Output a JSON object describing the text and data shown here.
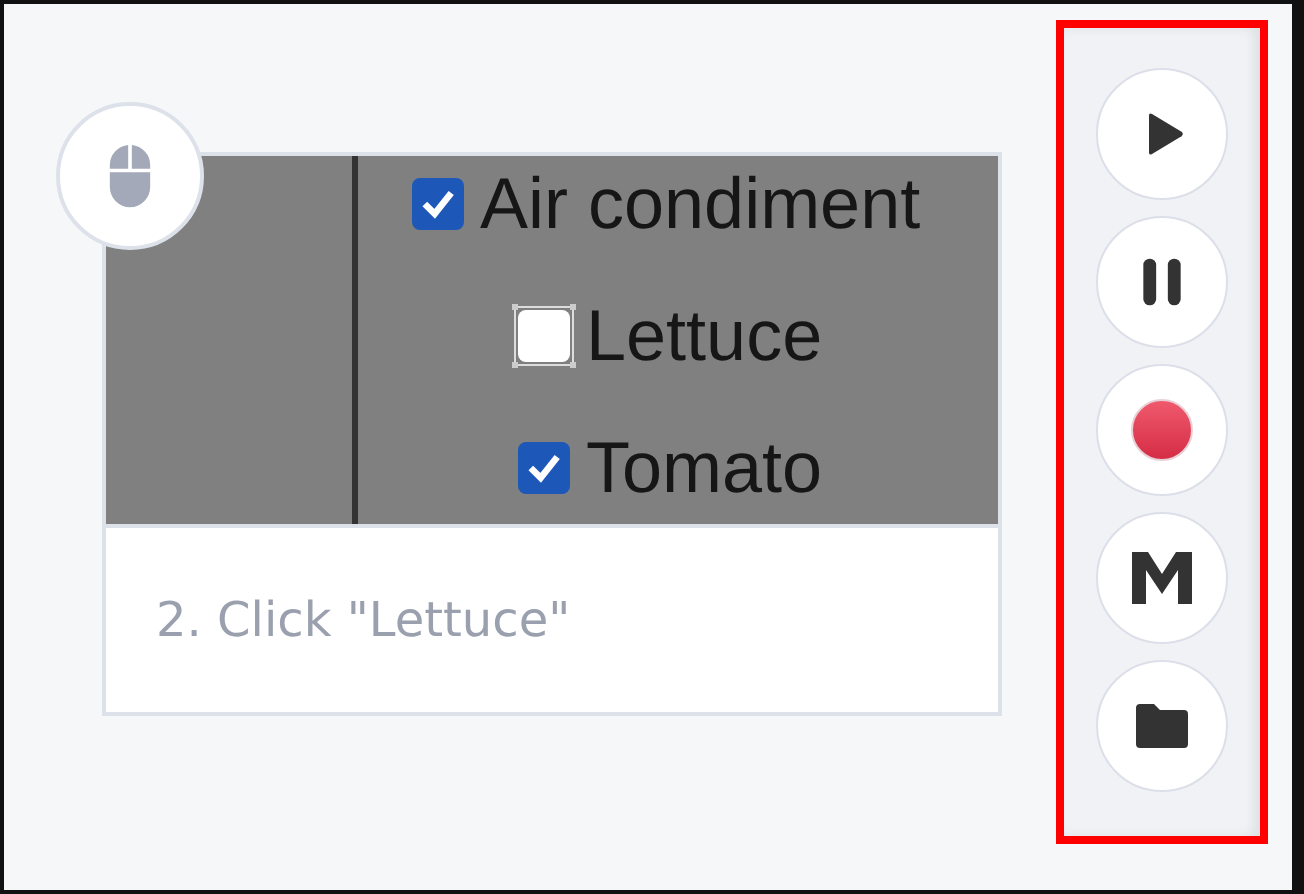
{
  "step": {
    "icon": {
      "kind": "mouse"
    },
    "screenshot": {
      "items": [
        {
          "label": "Air condiment",
          "checked": true,
          "highlighted": false,
          "children": [
            {
              "label": "Lettuce",
              "checked": false,
              "highlighted": true
            },
            {
              "label": "Tomato",
              "checked": true,
              "highlighted": false
            }
          ]
        }
      ]
    },
    "caption": "2. Click \"Lettuce\""
  },
  "toolbar": {
    "highlighted": true,
    "buttons": [
      {
        "kind": "play"
      },
      {
        "kind": "pause"
      },
      {
        "kind": "record"
      },
      {
        "kind": "logo"
      },
      {
        "kind": "folder"
      }
    ]
  }
}
